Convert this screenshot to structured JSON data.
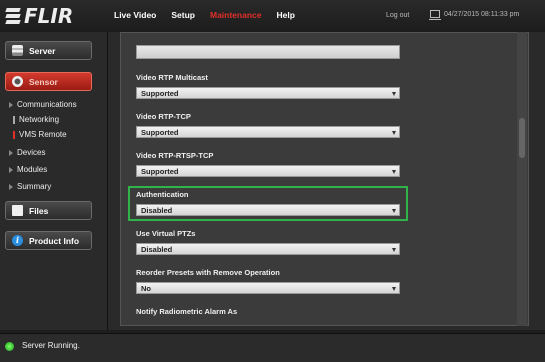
{
  "brand": {
    "logo_text": "FLIR"
  },
  "nav": {
    "items": [
      "Live Video",
      "Setup",
      "Maintenance",
      "Help"
    ],
    "active": "Maintenance",
    "logout": "Log out",
    "datetime": "04/27/2015 08:11:33 pm"
  },
  "sidebar": {
    "server_label": "Server",
    "sensor_label": "Sensor",
    "tree": {
      "communications": "Communications",
      "networking": "Networking",
      "vms_remote": "VMS Remote",
      "devices": "Devices",
      "modules": "Modules",
      "summary": "Summary"
    },
    "files_label": "Files",
    "product_info_label": "Product Info"
  },
  "form": {
    "fields": [
      {
        "label": "Video RTP Multicast",
        "value": "Supported"
      },
      {
        "label": "Video RTP-TCP",
        "value": "Supported"
      },
      {
        "label": "Video RTP-RTSP-TCP",
        "value": "Supported"
      },
      {
        "label": "Authentication",
        "value": "Disabled"
      },
      {
        "label": "Use Virtual PTZs",
        "value": "Disabled"
      },
      {
        "label": "Reorder Presets with Remove Operation",
        "value": "No"
      },
      {
        "label": "Notify Radiometric Alarm As",
        "value": ""
      }
    ]
  },
  "status": {
    "text": "Server Running.",
    "color": "#3ccf2f"
  },
  "colors": {
    "accent_red": "#e0302a",
    "highlight_green": "#2fb34a"
  }
}
